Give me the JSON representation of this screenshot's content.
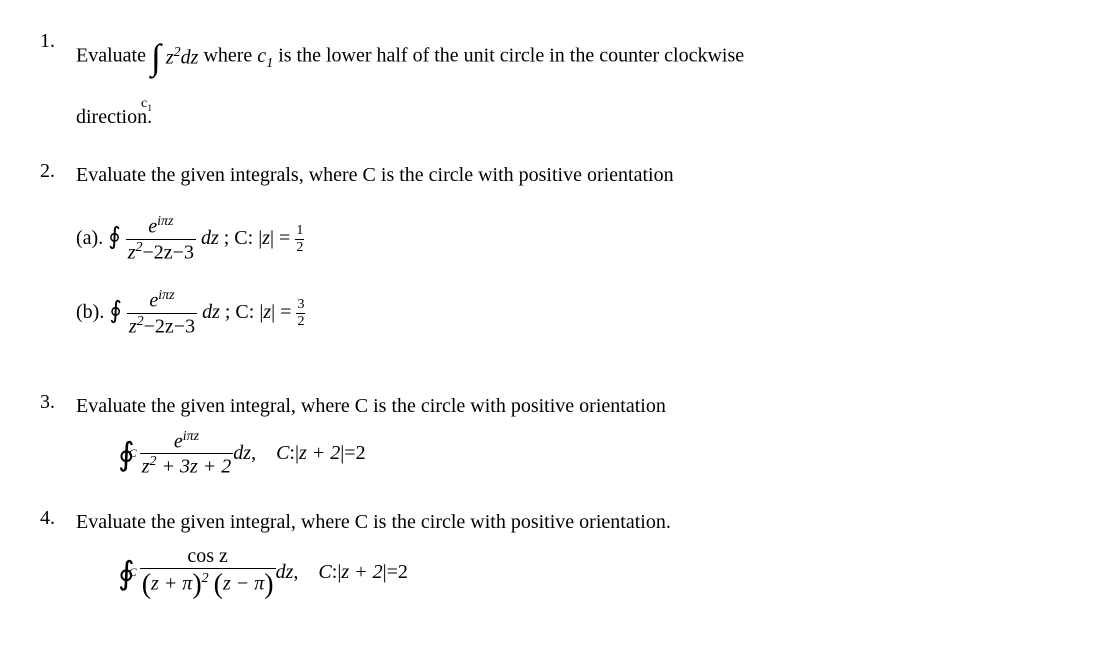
{
  "problems": {
    "p1": {
      "number": "1.",
      "text_before": "Evaluate ",
      "integral_var": "z",
      "integral_exp": "2",
      "integral_dvar": "dz",
      "integral_contour": "c",
      "integral_contour_sub": "1",
      "text_mid": " where ",
      "c_var": "c",
      "c_sub": "1",
      "text_after": " is the lower half of the unit circle in the counter clockwise",
      "text_line2": "direction."
    },
    "p2": {
      "number": "2.",
      "text": "Evaluate the given integrals, where C is the circle with positive orientation",
      "a": {
        "label": "(a). ",
        "num": "e",
        "num_exp": "iπz",
        "den": "z",
        "den_exp": "2",
        "den_rest": "−2z−3",
        "dz": "dz",
        "sep": ";  C: ",
        "abs_var": "z",
        "eq": " = ",
        "rhs_num": "1",
        "rhs_den": "2"
      },
      "b": {
        "label": "(b). ",
        "num": "e",
        "num_exp": "iπz",
        "den": "z",
        "den_exp": "2",
        "den_rest": "−2z−3",
        "dz": "dz",
        "sep": ";  C: ",
        "abs_var": "z",
        "eq": " = ",
        "rhs_num": "3",
        "rhs_den": "2"
      }
    },
    "p3": {
      "number": "3.",
      "text": "Evaluate the given integral, where C is the circle with positive orientation",
      "contour_sub": "C",
      "num": "e",
      "num_exp": "iπz",
      "den_var": "z",
      "den_exp": "2",
      "den_rest": " + 3z + 2",
      "dz": "dz",
      "comma": ",    ",
      "C_lbl": "C",
      "colon": " : ",
      "abs_expr": "z + 2",
      "eq": " = ",
      "rhs": "2"
    },
    "p4": {
      "number": "4.",
      "text": "Evaluate the given integral, where C is the circle with positive orientation.",
      "contour_sub": "C",
      "num": "cos z",
      "den_p1_var": "z + π",
      "den_p1_exp": "2",
      "den_p2_var": "z − π",
      "dz": "dz",
      "comma": ",    ",
      "C_lbl": "C",
      "colon": " : ",
      "abs_expr": "z + 2",
      "eq": " = ",
      "rhs": "2"
    }
  }
}
